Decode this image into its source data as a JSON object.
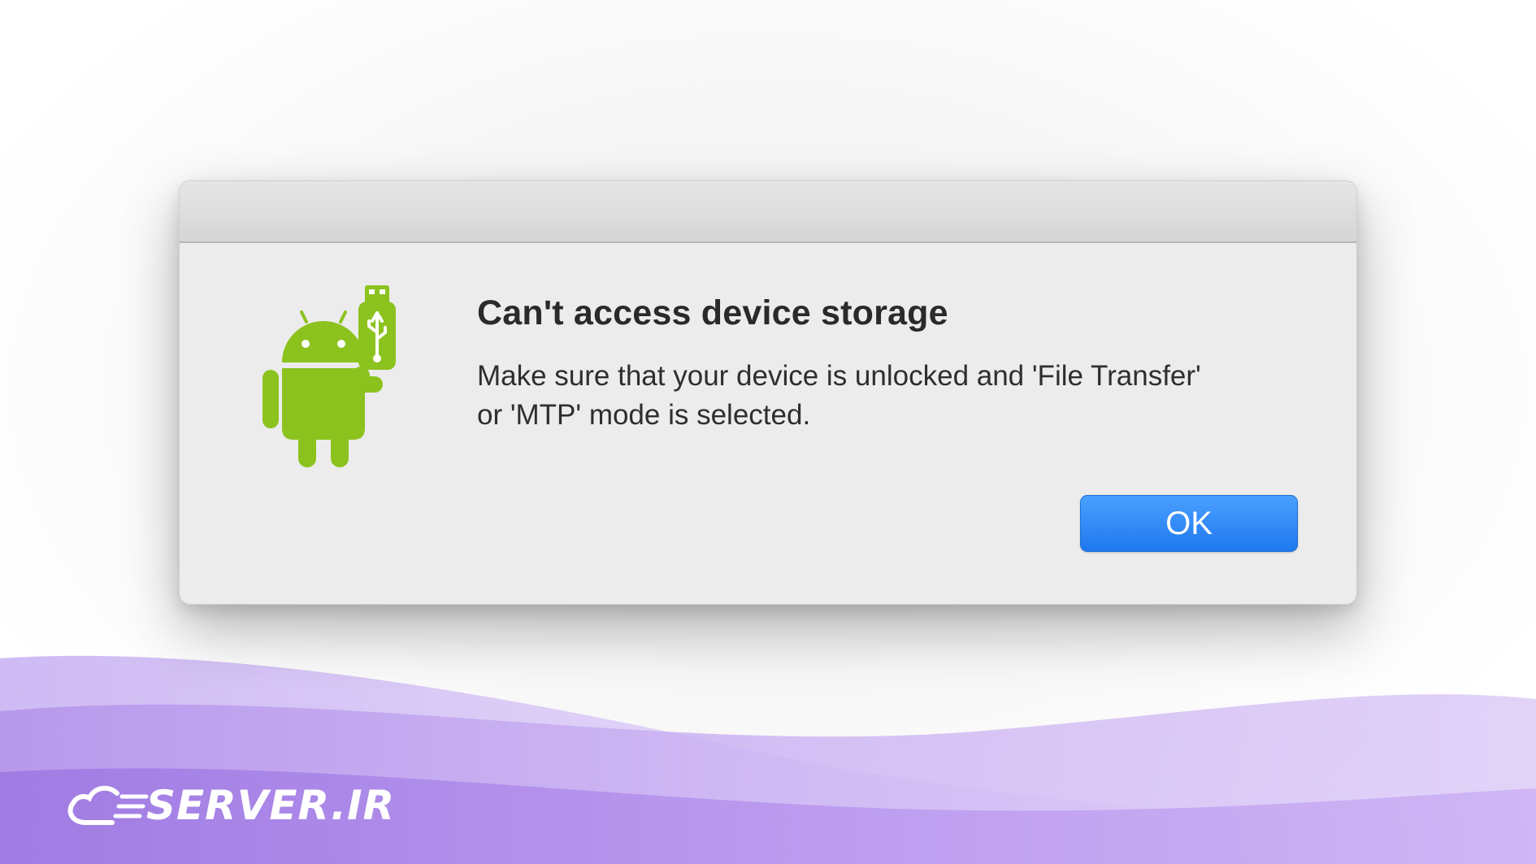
{
  "dialog": {
    "title": "Can't access device storage",
    "message": "Make sure that your device is unlocked and 'File Transfer' or 'MTP' mode is selected.",
    "ok_label": "OK",
    "icon": "android-usb-icon"
  },
  "brand": {
    "logo_text": "SERVER.IR"
  },
  "colors": {
    "android_green": "#8cc21e",
    "ok_button": "#1f78ee",
    "wave_purple": "#a98be6"
  }
}
